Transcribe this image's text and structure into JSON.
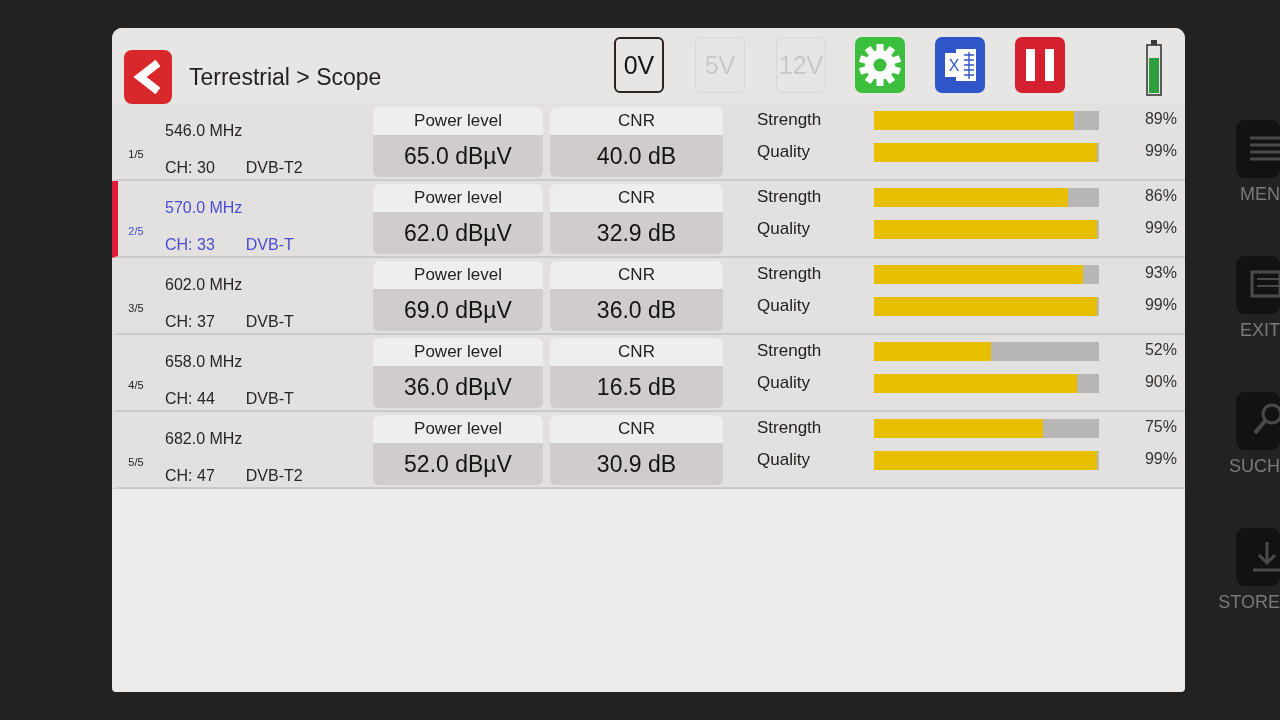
{
  "header": {
    "title": "Terrestrial > Scope",
    "voltage_buttons": [
      {
        "label": "0V",
        "selected": true,
        "disabled": false
      },
      {
        "label": "5V",
        "selected": false,
        "disabled": true
      },
      {
        "label": "12V",
        "selected": false,
        "disabled": true
      }
    ],
    "tools": [
      {
        "kind": "settings"
      },
      {
        "kind": "spreadsheet",
        "mark": "X"
      },
      {
        "kind": "pause"
      }
    ]
  },
  "channels": [
    {
      "index": "1/5",
      "frequency": "546.0 MHz",
      "channel": "CH: 30",
      "standard": "DVB-T2",
      "selected": false,
      "power": {
        "label": "Power level",
        "value": "65.0 dBµV"
      },
      "cnr": {
        "label": "CNR",
        "value": "40.0 dB"
      },
      "meters": [
        {
          "label": "Strength",
          "level": 0.89,
          "reading": "89%"
        },
        {
          "label": "Quality",
          "level": 0.99,
          "reading": "99%"
        }
      ]
    },
    {
      "index": "2/5",
      "frequency": "570.0 MHz",
      "channel": "CH: 33",
      "standard": "DVB-T",
      "selected": true,
      "power": {
        "label": "Power level",
        "value": "62.0 dBµV"
      },
      "cnr": {
        "label": "CNR",
        "value": "32.9 dB"
      },
      "meters": [
        {
          "label": "Strength",
          "level": 0.86,
          "reading": "86%"
        },
        {
          "label": "Quality",
          "level": 0.99,
          "reading": "99%"
        }
      ]
    },
    {
      "index": "3/5",
      "frequency": "602.0 MHz",
      "channel": "CH: 37",
      "standard": "DVB-T",
      "selected": false,
      "power": {
        "label": "Power level",
        "value": "69.0 dBµV"
      },
      "cnr": {
        "label": "CNR",
        "value": "36.0 dB"
      },
      "meters": [
        {
          "label": "Strength",
          "level": 0.93,
          "reading": "93%"
        },
        {
          "label": "Quality",
          "level": 0.99,
          "reading": "99%"
        }
      ]
    },
    {
      "index": "4/5",
      "frequency": "658.0 MHz",
      "channel": "CH: 44",
      "standard": "DVB-T",
      "selected": false,
      "power": {
        "label": "Power level",
        "value": "36.0 dBµV"
      },
      "cnr": {
        "label": "CNR",
        "value": "16.5 dB"
      },
      "meters": [
        {
          "label": "Strength",
          "level": 0.52,
          "reading": "52%"
        },
        {
          "label": "Quality",
          "level": 0.9,
          "reading": "90%"
        }
      ]
    },
    {
      "index": "5/5",
      "frequency": "682.0 MHz",
      "channel": "CH: 47",
      "standard": "DVB-T2",
      "selected": false,
      "power": {
        "label": "Power level",
        "value": "52.0 dBµV"
      },
      "cnr": {
        "label": "CNR",
        "value": "30.9 dB"
      },
      "meters": [
        {
          "label": "Strength",
          "level": 0.75,
          "reading": "75%"
        },
        {
          "label": "Quality",
          "level": 0.99,
          "reading": "99%"
        }
      ]
    }
  ],
  "side_keys": [
    {
      "kind": "menu",
      "label": "MEN"
    },
    {
      "kind": "exit",
      "label": "EXIT"
    },
    {
      "kind": "search",
      "label": "SUCH"
    },
    {
      "kind": "store",
      "label": "STORE"
    }
  ]
}
